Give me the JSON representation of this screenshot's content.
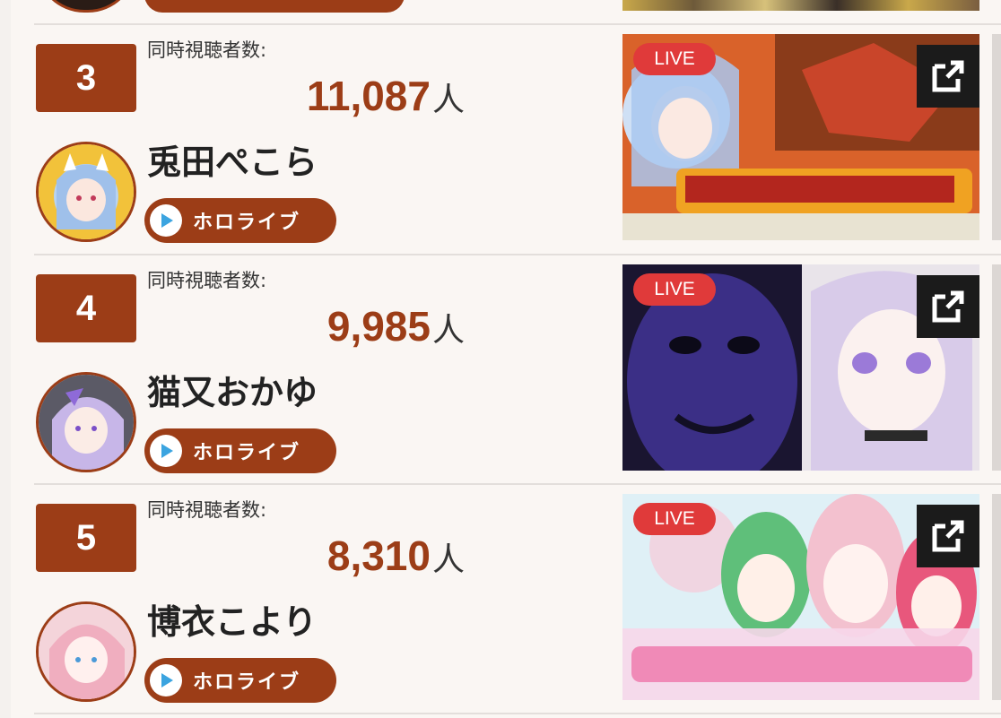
{
  "viewer_label": "同時視聴者数:",
  "unit": "人",
  "agency_label": "ホロライブ",
  "live_badge": "LIVE",
  "icons": {
    "external_link": "external-link-icon",
    "play": "play-icon"
  },
  "colors": {
    "accent": "#9c3d17",
    "live": "#e03a3a",
    "play": "#3ba4e0",
    "background": "#faf6f3"
  },
  "rankings": [
    {
      "rank": "3",
      "viewers": "11,087",
      "name": "兎田ぺこら"
    },
    {
      "rank": "4",
      "viewers": "9,985",
      "name": "猫又おかゆ"
    },
    {
      "rank": "5",
      "viewers": "8,310",
      "name": "博衣こより"
    }
  ]
}
